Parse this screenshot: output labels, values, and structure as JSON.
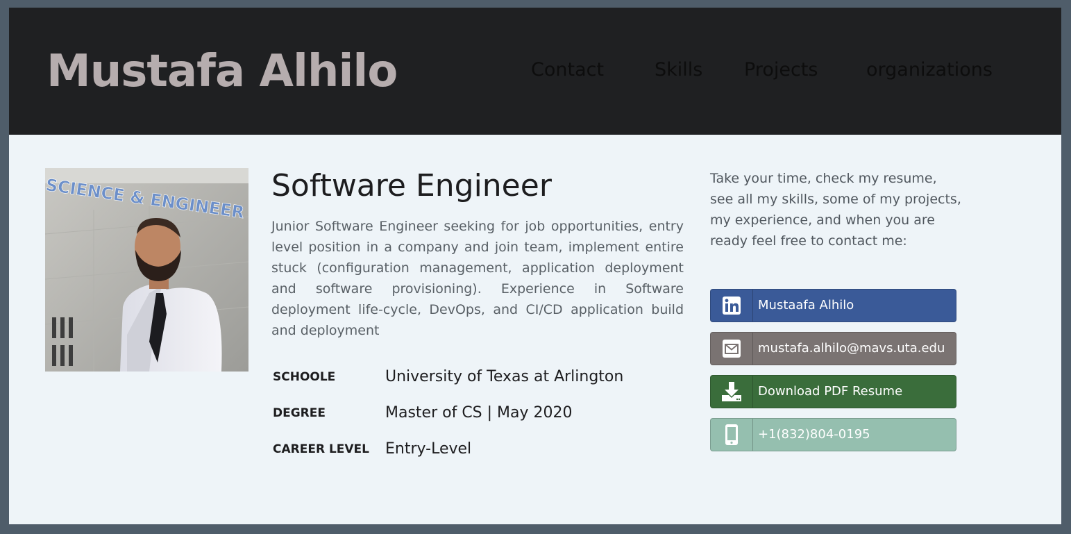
{
  "header": {
    "brand": "Mustafa Alhilo",
    "nav": [
      "Contact",
      "Skills",
      "Projects",
      "organizations"
    ]
  },
  "profile": {
    "photo_alt": "SCIENCE & ENGINEER",
    "title": "Software Engineer",
    "summary": "Junior Software Engineer seeking for job opportunities, entry level position in a company and join team, implement entire stuck (configuration management, application deployment and software provisioning). Experience in Software deployment life-cycle, DevOps, and CI/CD application build and deployment",
    "info": [
      {
        "label": "SCHOOLE",
        "value": "University of Texas at Arlington"
      },
      {
        "label": "DEGREE",
        "value": "Master of CS | May 2020"
      },
      {
        "label": "CAREER LEVEL",
        "value": "Entry-Level"
      }
    ]
  },
  "contact": {
    "intro": "Take your time, check my resume, see all my skills, some of my projects, my experience, and when you are ready feel free to contact me:",
    "buttons": [
      {
        "icon": "linkedin-icon",
        "label": "Mustaafa Alhilo",
        "color": "#3a5a98"
      },
      {
        "icon": "email-icon",
        "label": "mustafa.alhilo@mavs.uta.edu",
        "color": "#7a7372"
      },
      {
        "icon": "download-icon",
        "label": "Download PDF Resume",
        "color": "#3a6d3b"
      },
      {
        "icon": "phone-icon",
        "label": "+1(832)804-0195",
        "color": "#95bfaf"
      }
    ]
  },
  "colors": {
    "page_border": "#4f5d6a",
    "header_bg": "#1f2022",
    "brand_text": "#b6adae",
    "content_bg": "#eef4f8"
  }
}
